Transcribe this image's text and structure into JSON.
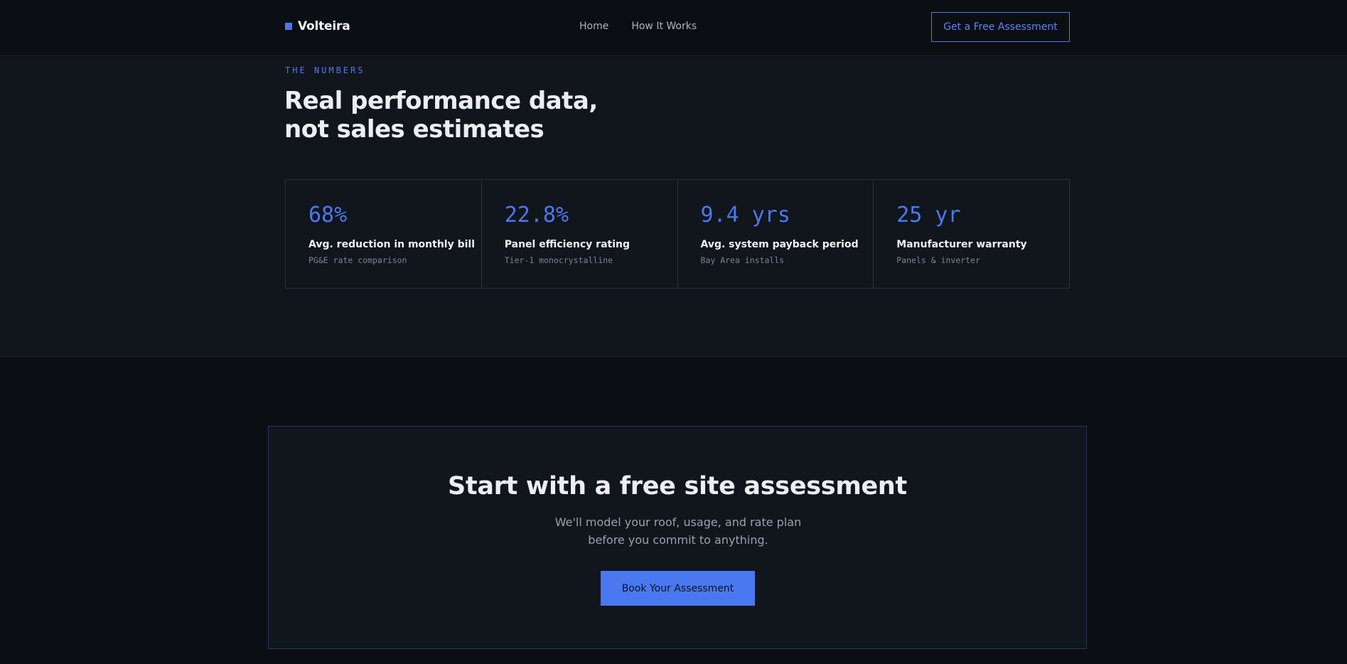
{
  "header": {
    "brand": "Volteira",
    "nav": [
      {
        "label": "Home"
      },
      {
        "label": "How It Works"
      }
    ],
    "cta_label": "Get a Free Assessment"
  },
  "numbers": {
    "eyebrow": "THE NUMBERS",
    "headline_line1": "Real performance data,",
    "headline_line2": "not sales estimates",
    "stats": [
      {
        "value": "68%",
        "label": "Avg. reduction in monthly bill",
        "sub": "PG&E rate comparison"
      },
      {
        "value": "22.8%",
        "label": "Panel efficiency rating",
        "sub": "Tier-1 monocrystalline"
      },
      {
        "value": "9.4 yrs",
        "label": "Avg. system payback period",
        "sub": "Bay Area installs"
      },
      {
        "value": "25 yr",
        "label": "Manufacturer warranty",
        "sub": "Panels & inverter"
      }
    ]
  },
  "cta": {
    "title": "Start with a free site assessment",
    "subtitle": "We'll model your roof, usage, and rate plan before you commit to anything.",
    "button_label": "Book Your Assessment"
  },
  "colors": {
    "accent": "#4a78f0",
    "background": "#0b0e13",
    "surface": "#11151c"
  }
}
